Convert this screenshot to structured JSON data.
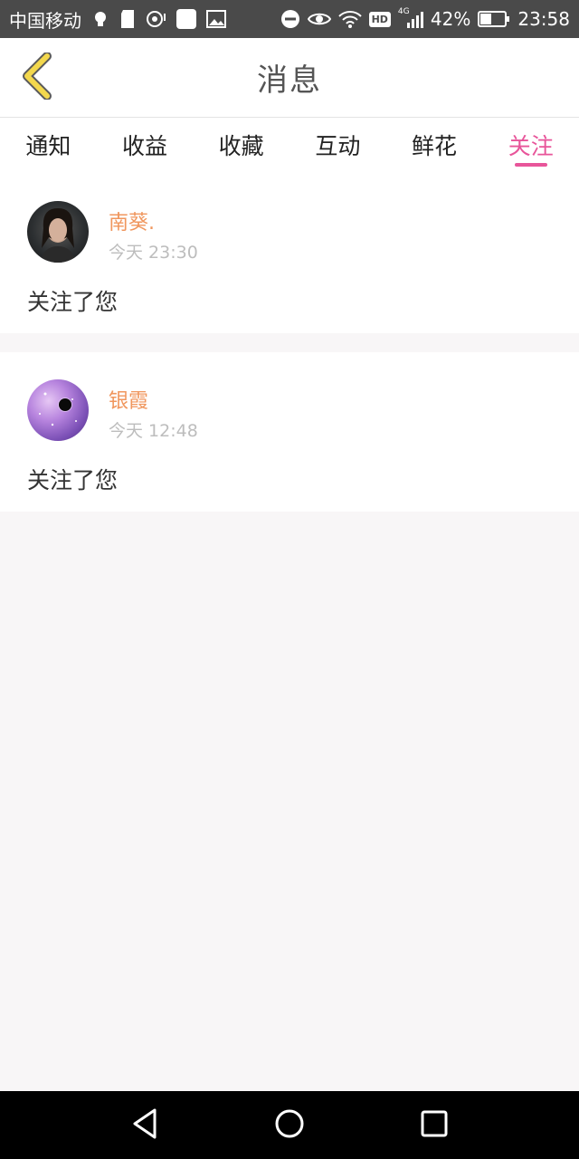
{
  "status_bar": {
    "carrier": "中国移动",
    "battery_percent": "42%",
    "time": "23:58",
    "hd_label": "HD",
    "network_label": "4G"
  },
  "header": {
    "title": "消息"
  },
  "tabs": [
    {
      "label": "通知",
      "active": false
    },
    {
      "label": "收益",
      "active": false
    },
    {
      "label": "收藏",
      "active": false
    },
    {
      "label": "互动",
      "active": false
    },
    {
      "label": "鲜花",
      "active": false
    },
    {
      "label": "关注",
      "active": true
    }
  ],
  "messages": [
    {
      "name": "南葵.",
      "time": "今天 23:30",
      "text": "关注了您"
    },
    {
      "name": "银霞",
      "time": "今天 12:48",
      "text": "关注了您"
    }
  ],
  "colors": {
    "accent": "#e8559a",
    "username": "#f0965d",
    "back_icon": "#f3d84d"
  }
}
